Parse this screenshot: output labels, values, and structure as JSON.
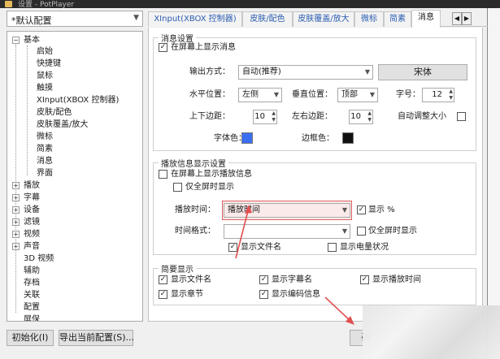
{
  "window": {
    "title": "设置 - PotPlayer"
  },
  "preset": {
    "value": "*默认配置"
  },
  "tree": {
    "root": "基本",
    "children": [
      "启始",
      "快捷键",
      "鼠标",
      "触摸",
      "XInput(XBOX 控制器)",
      "皮肤/配色",
      "皮肤覆盖/放大",
      "微标",
      "简素",
      "消息",
      "界面"
    ],
    "groups": [
      "播放",
      "字幕",
      "设备",
      "滤镜",
      "视频",
      "声音",
      "3D 视频",
      "辅助",
      "存档",
      "关联",
      "配置",
      "屏保"
    ]
  },
  "tabs": [
    "XInput(XBOX 控制器)",
    "皮肤/配色",
    "皮肤覆盖/放大",
    "微标",
    "简素",
    "消息"
  ],
  "active_tab": "消息",
  "message_settings": {
    "title": "消息设置",
    "show_on_screen": "在屏幕上显示消息",
    "output_label": "输出方式：",
    "output_value": "自动(推荐)",
    "font_button": "宋体",
    "h_pos_label": "水平位置：",
    "h_pos_value": "左侧",
    "v_pos_label": "垂直位置：",
    "v_pos_value": "顶部",
    "font_size_label": "字号：",
    "font_size_value": "12",
    "tb_margin_label": "上下边距：",
    "tb_margin_value": "10",
    "lr_margin_label": "左右边距：",
    "lr_margin_value": "10",
    "auto_size_label": "自动调整大小",
    "font_color_label": "字体色：",
    "border_color_label": "边框色：",
    "font_color": "#3b6ff2",
    "border_color": "#111111"
  },
  "playback_info": {
    "title": "播放信息显示设置",
    "show_on_screen": "在屏幕上显示播放信息",
    "fullscreen_only": "仅全屏时显示",
    "play_time_label": "播放时间：",
    "play_time_value": "播放时间",
    "show_percent": "显示 %",
    "time_format_label": "时间格式：",
    "time_format_value": "",
    "fullscreen_only_2": "仅全屏时显示",
    "show_filename": "显示文件名",
    "show_battery": "显示电量状况"
  },
  "brief": {
    "title": "简要显示",
    "items": [
      "显示文件名",
      "显示字幕名",
      "显示播放时间",
      "显示章节",
      "显示编码信息"
    ]
  },
  "buttons": {
    "init": "初始化(I)",
    "export": "导出当前配置(S)...",
    "ok": "确"
  },
  "colors": {
    "accent_red": "#e05050",
    "tab_link": "#2a5db0"
  }
}
